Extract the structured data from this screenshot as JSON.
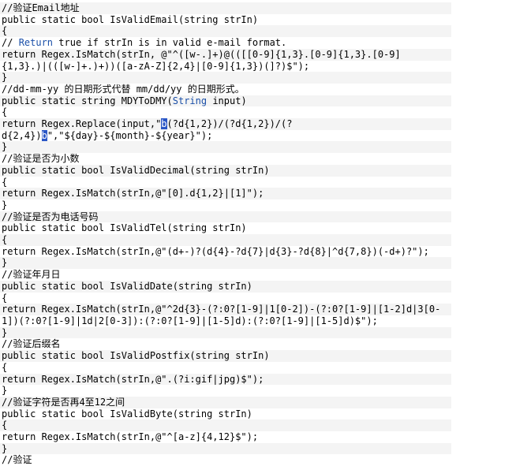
{
  "lines": [
    {
      "parts": [
        {
          "t": "//验证Email地址"
        }
      ]
    },
    {
      "parts": [
        {
          "t": "public static bool IsValidEmail(string strIn)"
        }
      ]
    },
    {
      "parts": [
        {
          "t": "{"
        }
      ]
    },
    {
      "parts": [
        {
          "t": "// "
        },
        {
          "t": "Return",
          "k": "kw"
        },
        {
          "t": " true if strIn is in valid e-mail format."
        }
      ]
    },
    {
      "parts": [
        {
          "t": "return Regex.IsMatch(strIn, @\"^([w-.]+)@(([[0-9]{1,3}.[0-9]{1,3}.[0-9]"
        }
      ]
    },
    {
      "parts": [
        {
          "t": "{1,3}.)|(([w-]+.)+))([a-zA-Z]{2,4}|[0-9]{1,3})(]?)$\");"
        }
      ]
    },
    {
      "parts": [
        {
          "t": "}"
        }
      ]
    },
    {
      "parts": [
        {
          "t": "//dd-mm-yy 的日期形式代替 mm/dd/yy 的日期形式。"
        }
      ]
    },
    {
      "parts": [
        {
          "t": "public static string MDYToDMY("
        },
        {
          "t": "String",
          "k": "kw"
        },
        {
          "t": " input)"
        }
      ]
    },
    {
      "parts": [
        {
          "t": "{"
        }
      ]
    },
    {
      "parts": [
        {
          "t": "return Regex.Replace(input,\""
        },
        {
          "t": "b",
          "k": "sel"
        },
        {
          "t": "(?d{1,2})/(?d{1,2})/(?"
        }
      ]
    },
    {
      "parts": [
        {
          "t": "d{2,4})"
        },
        {
          "t": "b",
          "k": "sel"
        },
        {
          "t": "\",\"${day}-${month}-${year}\");"
        }
      ]
    },
    {
      "parts": [
        {
          "t": "}"
        }
      ]
    },
    {
      "parts": [
        {
          "t": "//验证是否为小数"
        }
      ]
    },
    {
      "parts": [
        {
          "t": "public static bool IsValidDecimal(string strIn)"
        }
      ]
    },
    {
      "parts": [
        {
          "t": "{"
        }
      ]
    },
    {
      "parts": [
        {
          "t": "return Regex.IsMatch(strIn,@\"[0].d{1,2}|[1]\");"
        }
      ]
    },
    {
      "parts": [
        {
          "t": "}"
        }
      ]
    },
    {
      "parts": [
        {
          "t": "//验证是否为电话号码"
        }
      ]
    },
    {
      "parts": [
        {
          "t": "public static bool IsValidTel(string strIn)"
        }
      ]
    },
    {
      "parts": [
        {
          "t": "{"
        }
      ]
    },
    {
      "parts": [
        {
          "t": "return Regex.IsMatch(strIn,@\"(d+-)?(d{4}-?d{7}|d{3}-?d{8}|^d{7,8})(-d+)?\");"
        }
      ]
    },
    {
      "parts": [
        {
          "t": "}"
        }
      ]
    },
    {
      "parts": [
        {
          "t": "//验证年月日"
        }
      ]
    },
    {
      "parts": [
        {
          "t": "public static bool IsValidDate(string strIn)"
        }
      ]
    },
    {
      "parts": [
        {
          "t": "{"
        }
      ]
    },
    {
      "parts": [
        {
          "t": "return Regex.IsMatch(strIn,@\"^2d{3}-(?:0?[1-9]|1[0-2])-(?:0?[1-9]|[1-2]d|3[0-"
        }
      ]
    },
    {
      "parts": [
        {
          "t": "1])(?:0?[1-9]|1d|2[0-3]):(?:0?[1-9]|[1-5]d):(?:0?[1-9]|[1-5]d)$\");"
        }
      ]
    },
    {
      "parts": [
        {
          "t": "}"
        }
      ]
    },
    {
      "parts": [
        {
          "t": "//验证后缀名"
        }
      ]
    },
    {
      "parts": [
        {
          "t": "public static bool IsValidPostfix(string strIn)"
        }
      ]
    },
    {
      "parts": [
        {
          "t": "{"
        }
      ]
    },
    {
      "parts": [
        {
          "t": "return Regex.IsMatch(strIn,@\".(?i:gif|jpg)$\");"
        }
      ]
    },
    {
      "parts": [
        {
          "t": "}"
        }
      ]
    },
    {
      "parts": [
        {
          "t": "//验证字符是否再4至12之间"
        }
      ]
    },
    {
      "parts": [
        {
          "t": "public static bool IsValidByte(string strIn)"
        }
      ]
    },
    {
      "parts": [
        {
          "t": "{"
        }
      ]
    },
    {
      "parts": [
        {
          "t": "return Regex.IsMatch(strIn,@\"^[a-z]{4,12}$\");"
        }
      ]
    },
    {
      "parts": [
        {
          "t": "}"
        }
      ]
    },
    {
      "parts": [
        {
          "t": "//验证"
        }
      ]
    }
  ]
}
